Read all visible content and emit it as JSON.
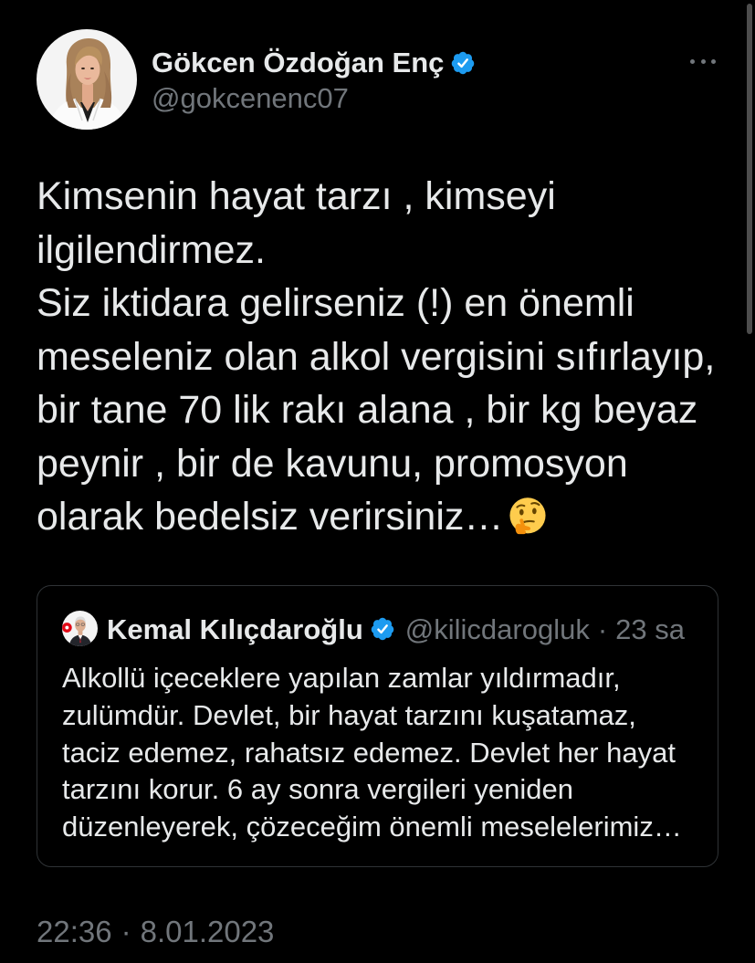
{
  "tweet": {
    "author": {
      "name": "Gökcen Özdoğan Enç",
      "handle": "@gokcenenc07",
      "verified": true
    },
    "text_lines": [
      "Kimsenin hayat tarzı , kimseyi",
      "ilgilendirmez.",
      "Siz iktidara gelirseniz (!) en önemli",
      "meseleniz olan alkol vergisini sıfırlayıp,",
      "bir tane 70 lik rakı alana , bir kg beyaz",
      "peynir , bir de kavunu, promosyon",
      "olarak bedelsiz verirsiniz…"
    ],
    "trailing_emoji": "thinking-face",
    "quoted": {
      "author": {
        "name": "Kemal Kılıçdaroğlu",
        "handle": "@kilicdarogluk",
        "verified": true
      },
      "separator": "·",
      "age": "23 sa",
      "text_lines": [
        "Alkollü içeceklere yapılan zamlar yıldırmadır,",
        "zulümdür. Devlet, bir hayat tarzını kuşatamaz,",
        "taciz edemez, rahatsız edemez. Devlet her hayat",
        "tarzını korur. 6 ay sonra vergileri yeniden",
        "düzenleyerek, çözeceğim önemli meselelerimiz…"
      ]
    },
    "time": "22:36",
    "separator": "·",
    "date": "8.01.2023"
  },
  "icons": {
    "verified": "verified-badge-icon",
    "more": "more-horizontal-icon",
    "emoji": "thinking-face-emoji-icon"
  },
  "colors": {
    "background": "#000000",
    "text": "#e7e9ea",
    "secondary_text": "#71767b",
    "verified": "#1d9bf0",
    "border": "#2f3336"
  }
}
